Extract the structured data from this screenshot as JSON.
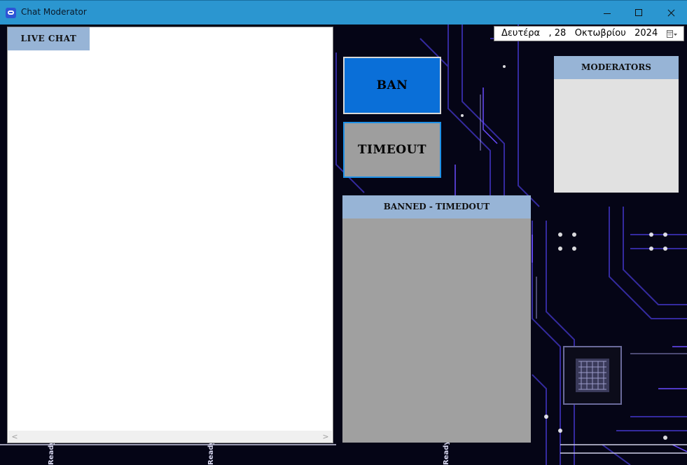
{
  "window": {
    "title": "Chat Moderator"
  },
  "live_chat": {
    "label": "LIVE CHAT"
  },
  "date_picker": {
    "value": "Δευτέρα   , 28   Οκτωβρίου   2024"
  },
  "actions": {
    "ban_label": "BAN",
    "timeout_label": "TIMEOUT"
  },
  "moderators": {
    "label": "MODERATORS"
  },
  "banned": {
    "label": "BANNED - TIMEDOUT"
  },
  "colors": {
    "titlebar": "#2b96d0",
    "panel_header": "#97b4d6",
    "ban_button": "#0a6fd8",
    "timeout_button": "#9e9e9e",
    "background": "#050516",
    "circuit_accent": "#6a4cff"
  },
  "icons": {
    "app": "chat-bubble-icon",
    "minimize": "minimize-icon",
    "maximize": "maximize-icon",
    "close": "close-icon",
    "calendar": "calendar-dropdown-icon"
  }
}
